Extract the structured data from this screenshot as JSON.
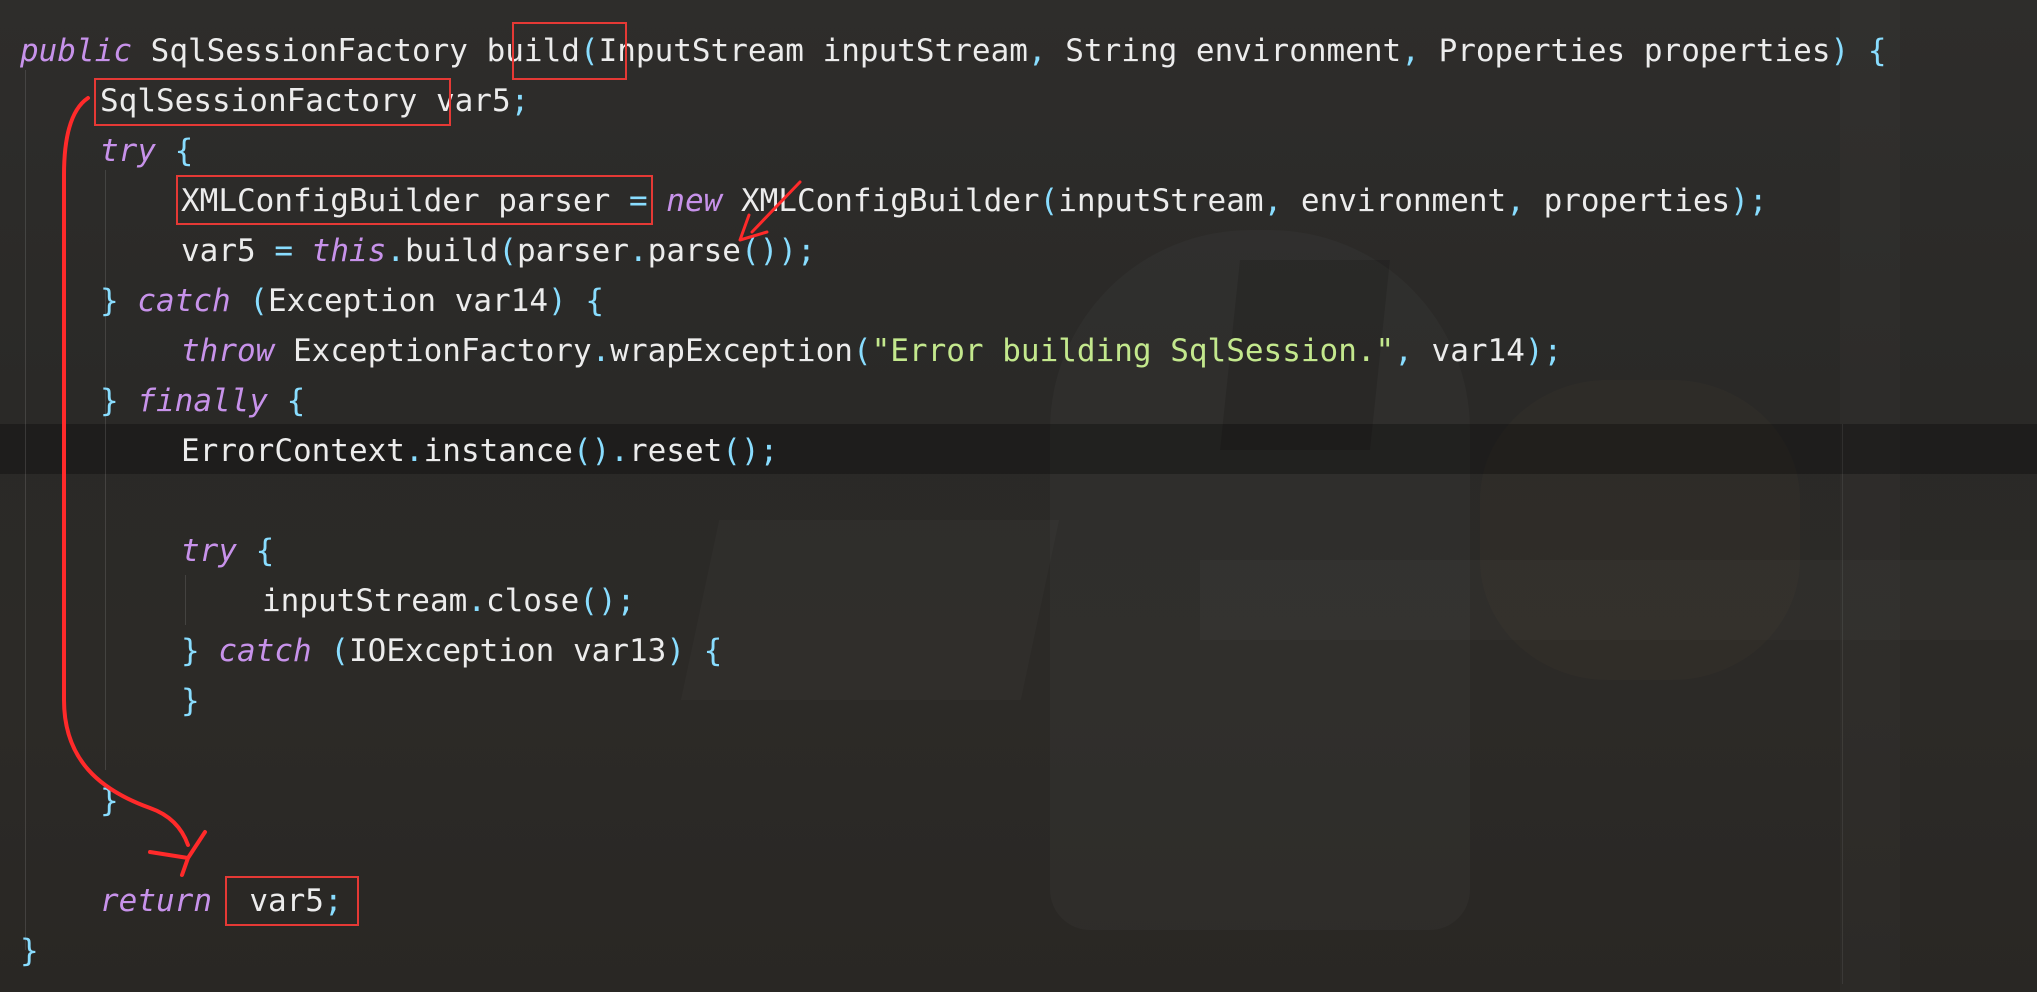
{
  "code": {
    "line1": {
      "kw": "public",
      "type": "SqlSessionFactory",
      "method": "build",
      "open": "(",
      "p1type": "InputStream",
      "p1": "inputStream",
      "comma1": ",",
      "p2type": "String",
      "p2": "environment",
      "comma2": ",",
      "p3type": "Properties",
      "p3": "properties",
      "close": ")",
      "brace": "{"
    },
    "line2": {
      "type": "SqlSessionFactory",
      "var": "var5",
      "semi": ";"
    },
    "line3": {
      "kw": "try",
      "brace": "{"
    },
    "line4": {
      "decl": "XMLConfigBuilder parser",
      "eq": "=",
      "kw": "new",
      "cls": "XMLConfigBuilder",
      "open": "(",
      "a1": "inputStream",
      "c1": ",",
      "a2": "environment",
      "c2": ",",
      "a3": "properties",
      "close": ");"
    },
    "line5": {
      "lhs": "var5",
      "eq": "=",
      "kw": "this",
      "dot1": ".",
      "call": "build",
      "open1": "(",
      "obj": "parser",
      "dot2": ".",
      "call2": "parse",
      "close": "());"
    },
    "line6": {
      "brace": "}",
      "kw": "catch",
      "open": "(",
      "type": "Exception",
      "var": "var14",
      "close": ")",
      "brace2": "{"
    },
    "line7": {
      "kw": "throw",
      "cls": "ExceptionFactory",
      "dot": ".",
      "call": "wrapException",
      "open": "(",
      "str": "\"Error building SqlSession.\"",
      "comma": ",",
      "arg": "var14",
      "close": ");"
    },
    "line8": {
      "brace": "}",
      "kw": "finally",
      "brace2": "{"
    },
    "line9": {
      "cls": "ErrorContext",
      "dot1": ".",
      "call1": "instance",
      "p1": "()",
      "dot2": ".",
      "call2": "reset",
      "p2": "();"
    },
    "line11": {
      "kw": "try",
      "brace": "{"
    },
    "line12": {
      "obj": "inputStream",
      "dot": ".",
      "call": "close",
      "p": "();"
    },
    "line13": {
      "brace": "}",
      "kw": "catch",
      "open": "(",
      "type": "IOException",
      "var": "var13",
      "close": ")",
      "brace2": "{"
    },
    "line14": {
      "brace": "}"
    },
    "line16": {
      "brace": "}"
    },
    "line18": {
      "kw": "return",
      "var": "var5",
      "semi": ";"
    },
    "line19": {
      "brace": "}"
    }
  },
  "colors": {
    "keyword": "#c792ea",
    "punctuation": "#89ddff",
    "string": "#c3e88d",
    "identifier": "#ececec",
    "annotation": "#e53935"
  },
  "annotations": [
    "red-box",
    "red-box",
    "red-box",
    "red-box",
    "red-arrow",
    "red-arrow"
  ]
}
